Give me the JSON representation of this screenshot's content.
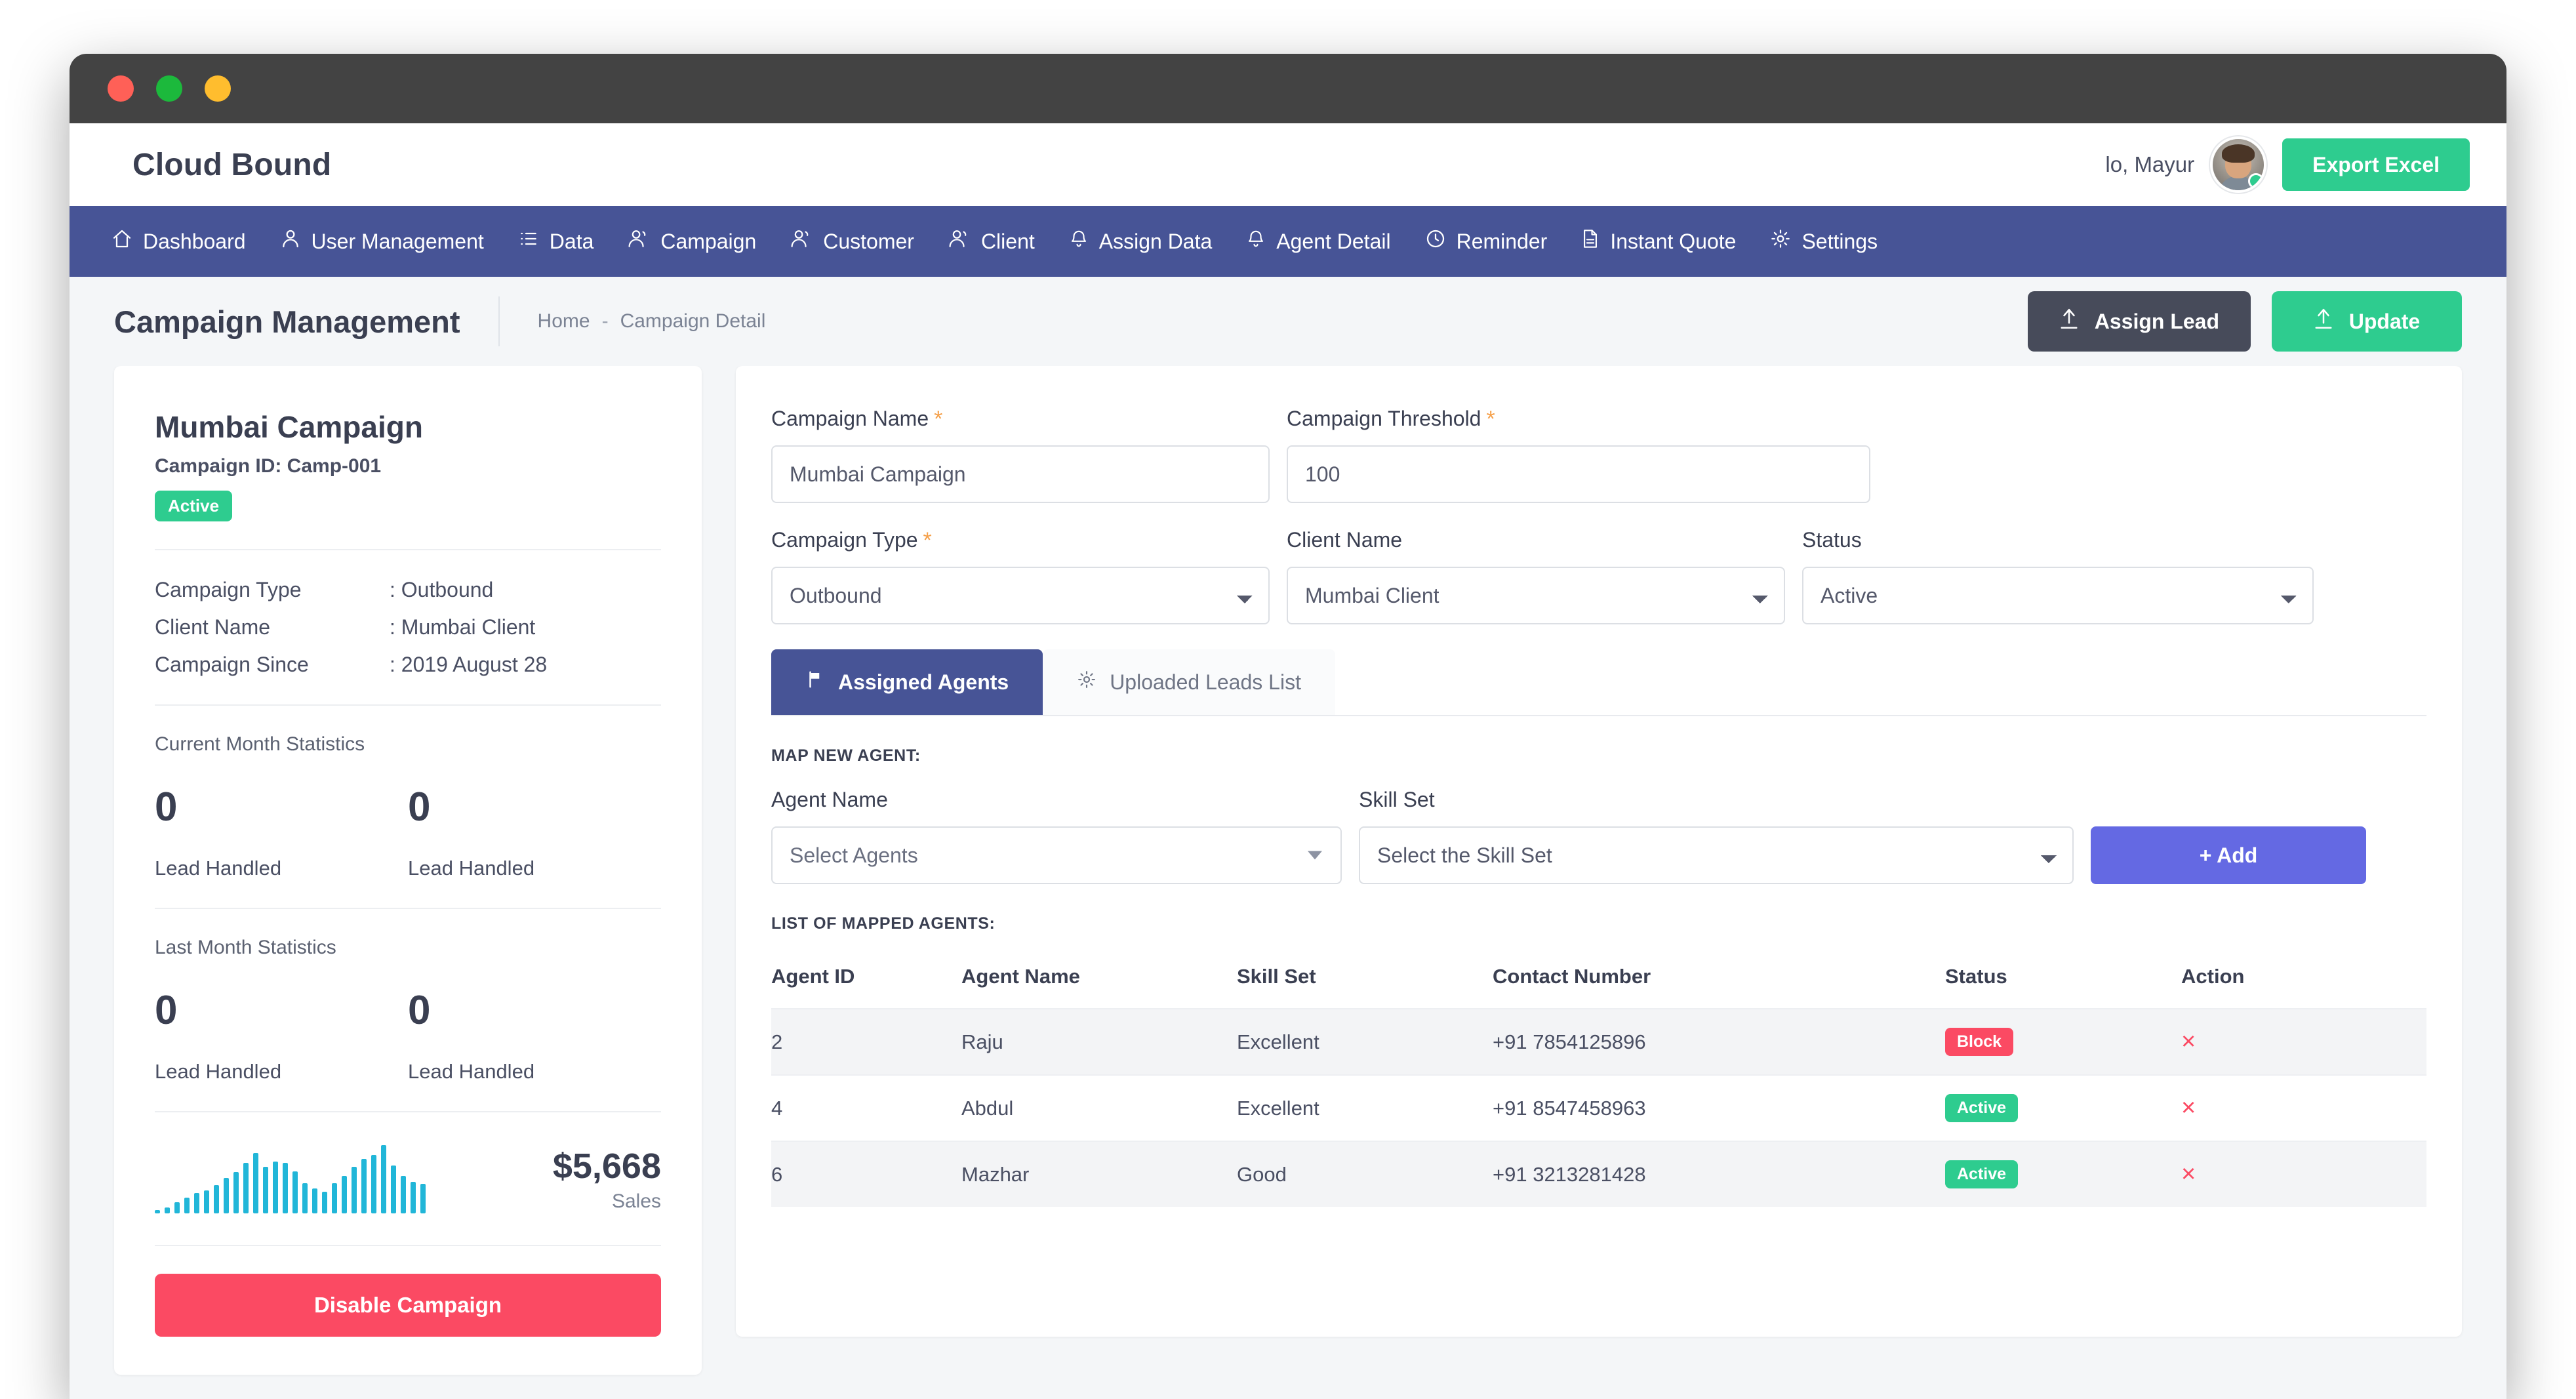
{
  "window": {
    "traffic_lights": [
      "red",
      "green",
      "yellow"
    ]
  },
  "header": {
    "brand_title": "Cloud Bound",
    "greeting": "lo,  Mayur",
    "export_label": "Export Excel",
    "accent_green": "#2ecc8f"
  },
  "nav": {
    "background": "#475496",
    "items": [
      {
        "label": "Dashboard",
        "icon": "home-icon"
      },
      {
        "label": "User Management",
        "icon": "user-icon"
      },
      {
        "label": "Data",
        "icon": "list-icon"
      },
      {
        "label": "Campaign",
        "icon": "users-icon"
      },
      {
        "label": "Customer",
        "icon": "users-icon"
      },
      {
        "label": "Client",
        "icon": "users-icon"
      },
      {
        "label": "Assign Data",
        "icon": "bell-icon"
      },
      {
        "label": "Agent Detail",
        "icon": "bell-icon"
      },
      {
        "label": "Reminder",
        "icon": "clock-icon"
      },
      {
        "label": "Instant Quote",
        "icon": "document-icon"
      },
      {
        "label": "Settings",
        "icon": "gear-icon"
      }
    ]
  },
  "page": {
    "title": "Campaign Management",
    "breadcrumb": {
      "home": "Home",
      "separator": "-",
      "current": "Campaign Detail"
    },
    "assign_lead_label": "Assign Lead",
    "update_label": "Update"
  },
  "summary": {
    "campaign_name": "Mumbai Campaign",
    "campaign_id": "Campaign ID: Camp-001",
    "status_badge": "Active",
    "details": [
      {
        "key": "Campaign Type",
        "value": ": Outbound"
      },
      {
        "key": "Client Name",
        "value": ": Mumbai Client"
      },
      {
        "key": "Campaign Since",
        "value": ": 2019 August 28"
      }
    ],
    "current_month_label": "Current Month Statistics",
    "current_month": [
      {
        "value": "0",
        "caption": "Lead Handled"
      },
      {
        "value": "0",
        "caption": "Lead Handled"
      }
    ],
    "last_month_label": "Last Month Statistics",
    "last_month": [
      {
        "value": "0",
        "caption": "Lead Handled"
      },
      {
        "value": "0",
        "caption": "Lead Handled"
      }
    ],
    "sales_amount": "$5,668",
    "sales_caption": "Sales",
    "disable_label": "Disable Campaign",
    "sparkline_color": "#21b6d8",
    "sparkline_values": [
      5,
      9,
      16,
      23,
      30,
      34,
      41,
      52,
      61,
      74,
      88,
      68,
      76,
      74,
      62,
      44,
      37,
      32,
      44,
      55,
      68,
      80,
      86,
      100,
      70,
      55,
      46,
      43
    ]
  },
  "form": {
    "campaign_name": {
      "label": "Campaign Name",
      "required": true,
      "value": "Mumbai Campaign"
    },
    "campaign_threshold": {
      "label": "Campaign Threshold",
      "required": true,
      "value": "100"
    },
    "campaign_type": {
      "label": "Campaign Type",
      "required": true,
      "value": "Outbound"
    },
    "client_name": {
      "label": "Client Name",
      "required": false,
      "value": "Mumbai Client"
    },
    "status": {
      "label": "Status",
      "required": false,
      "value": "Active"
    }
  },
  "tabs": [
    {
      "label": "Assigned Agents",
      "icon": "flag-icon",
      "active": true
    },
    {
      "label": "Uploaded Leads List",
      "icon": "gear-icon",
      "active": false
    }
  ],
  "map_agent": {
    "section_caption": "MAP NEW AGENT:",
    "agent_name_label": "Agent Name",
    "agent_name_value": "Select Agents",
    "skill_set_label": "Skill Set",
    "skill_set_value": "Select the Skill Set",
    "add_label": "+  Add",
    "add_color": "#6469e3"
  },
  "agents_list": {
    "section_caption": "LIST OF MAPPED AGENTS:",
    "columns": [
      "Agent ID",
      "Agent Name",
      "Skill Set",
      "Contact Number",
      "Status",
      "Action"
    ],
    "rows": [
      {
        "id": "2",
        "name": "Raju",
        "skill": "Excellent",
        "contact": "+91 7854125896",
        "status": "Block",
        "status_kind": "block",
        "action": "×"
      },
      {
        "id": "4",
        "name": "Abdul",
        "skill": "Excellent",
        "contact": "+91 8547458963",
        "status": "Active",
        "status_kind": "active",
        "action": "×"
      },
      {
        "id": "6",
        "name": "Mazhar",
        "skill": "Good",
        "contact": "+91 3213281428",
        "status": "Active",
        "status_kind": "active",
        "action": "×"
      }
    ]
  }
}
